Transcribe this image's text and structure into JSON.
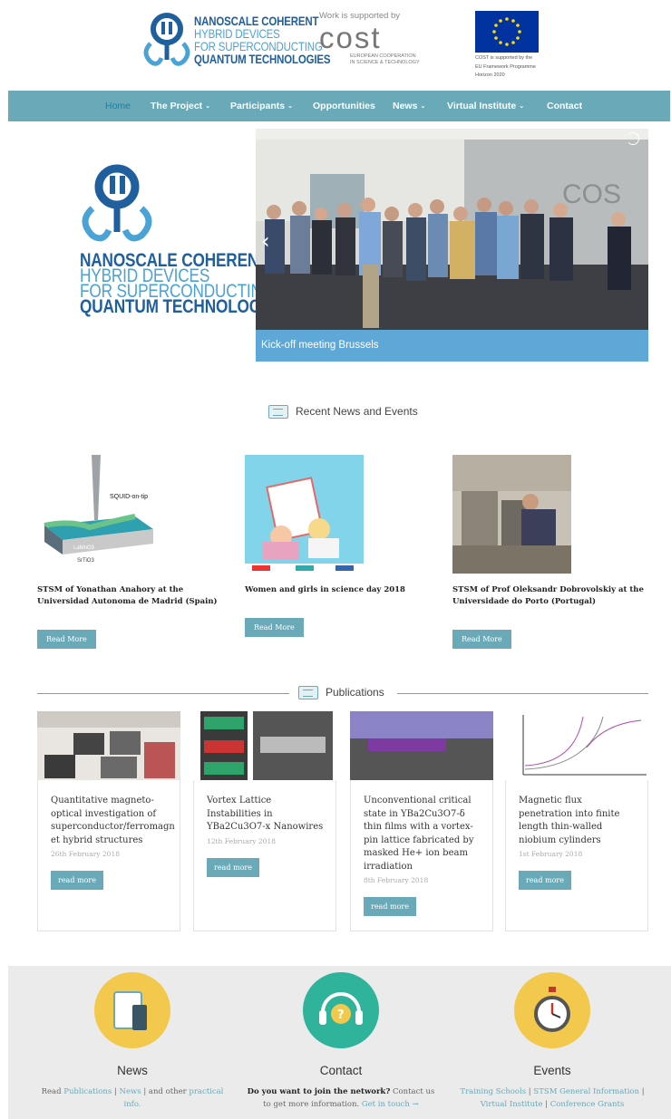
{
  "header": {
    "logo_lines": [
      "NANOSCALE COHERENT",
      "HYBRID DEVICES",
      "FOR SUPERCONDUCTING",
      "QUANTUM TECHNOLOGIES"
    ],
    "support_caption": "Work is supported by",
    "cost_logo": "cost",
    "cost_sub": [
      "EUROPEAN COOPERATION",
      "IN SCIENCE & TECHNOLOGY"
    ],
    "eu_caption": [
      "COST is supported by the",
      "EU Framework Programme",
      "Horizon 2020"
    ]
  },
  "nav": [
    {
      "label": "Home",
      "dropdown": false,
      "active": true
    },
    {
      "label": "The Project",
      "dropdown": true
    },
    {
      "label": "Participants",
      "dropdown": true
    },
    {
      "label": "Opportunities",
      "dropdown": false
    },
    {
      "label": "News",
      "dropdown": true
    },
    {
      "label": "Virtual Institute",
      "dropdown": true
    },
    {
      "label": "Contact",
      "dropdown": false
    }
  ],
  "hero": {
    "logo_lines": [
      "NANOSCALE COHERENT",
      "HYBRID DEVICES",
      "FOR SUPERCONDUCTING",
      "QUANTUM TECHNOLOGIES"
    ],
    "slide_caption": "Kick-off meeting Brussels",
    "slide_wall_text": "COS"
  },
  "recent": {
    "heading": "Recent News and Events",
    "items": [
      {
        "title": "STSM of Yonathan Anahory at the Universidad Autonoma de Madrid (Spain)",
        "button": "Read More",
        "thumb_labels": [
          "SQUID-on-tip",
          "LaMnO3",
          "SrTiO3"
        ]
      },
      {
        "title": "Women and girls in science day 2018",
        "button": "Read More"
      },
      {
        "title": "STSM of Prof Oleksandr Dobrovolskiy at the Universidade do Porto (Portugal)",
        "button": "Read More"
      }
    ]
  },
  "publications": {
    "heading": "Publications",
    "items": [
      {
        "title": "Quantitative magneto-optical investigation of superconductor/ferromagn et hybrid structures",
        "date": "26th February 2018",
        "button": "read more"
      },
      {
        "title": "Vortex Lattice Instabilities in YBa2Cu3O7-x Nanowires",
        "date": "12th February 2018",
        "button": "read more"
      },
      {
        "title": "Unconventional critical state in YBa2Cu3O7-δ thin films with a vortex-pin lattice fabricated by masked He+ ion beam irradiation",
        "date": "8th February 2018",
        "button": "read more"
      },
      {
        "title": "Magnetic flux penetration into finite length thin-walled niobium cylinders",
        "date": "1st February 2018",
        "button": "read more"
      }
    ]
  },
  "footer": {
    "news": {
      "heading": "News",
      "pre": "Read ",
      "link1": "Publications",
      "sep1": " | ",
      "link2": "News",
      "post": " | and other ",
      "link3": "practical info."
    },
    "contact": {
      "heading": "Contact",
      "bold": "Do you want to join the network?",
      "text": " Contact us to get more information. ",
      "link": "Get in touch →"
    },
    "events": {
      "heading": "Events",
      "link1": "Training Schools",
      "sep1": " | ",
      "link2": "STSM General Information",
      "sep2": " | ",
      "link3": "Virtual Institute",
      "sep3": " | ",
      "link4": "Conference Grants"
    }
  },
  "colors": {
    "accent": "#6aa9b8",
    "brand_blue": "#1f5f9e",
    "light_blue": "#4aa3d6",
    "slide_caption": "#5da8d7",
    "footer_bg": "#ebebeb",
    "yellow": "#f2c94c",
    "teal": "#2fb39b"
  }
}
